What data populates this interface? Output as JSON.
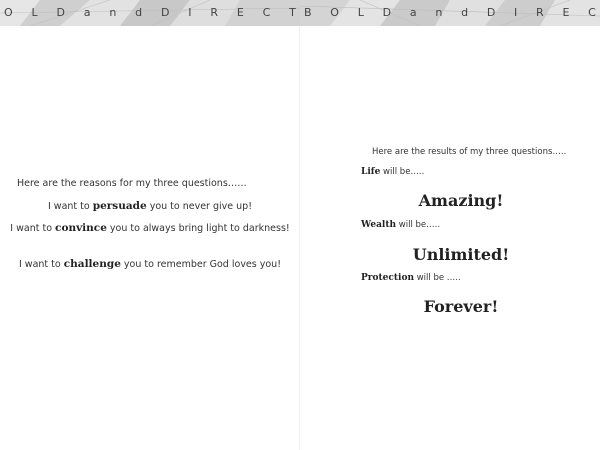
{
  "header": {
    "left_letters": [
      "O",
      "L",
      "D",
      "a",
      "n",
      "d",
      "D",
      "I",
      "R",
      "E",
      "C",
      "T"
    ],
    "right_letters": [
      "B",
      "O",
      "L",
      "D",
      "a",
      "n",
      "d",
      "D",
      "I",
      "R",
      "E",
      "C"
    ]
  },
  "left_page": {
    "intro": "Here are the reasons for my three questions……",
    "reasons": [
      {
        "pre": "I want to ",
        "bold": "persuade",
        "post": " you to never give up!"
      },
      {
        "pre": "I want to ",
        "bold": "convince",
        "post": " you to always bring light to darkness!"
      },
      {
        "pre": "I want to ",
        "bold": "challenge",
        "post": " you to remember God loves you!"
      }
    ]
  },
  "right_page": {
    "intro": "Here are the results of my three questions…..",
    "results": [
      {
        "label_bold": "Life",
        "label_rest": " will be…..",
        "value": "Amazing!"
      },
      {
        "label_bold": "Wealth",
        "label_rest": " will be…..",
        "value": "Unlimited!"
      },
      {
        "label_bold": "Protection",
        "label_rest": " will be …..",
        "value": "Forever!"
      }
    ]
  },
  "colors": {
    "header_band": "#d9d9d9",
    "text": "#333333",
    "emphasis": "#222222"
  }
}
